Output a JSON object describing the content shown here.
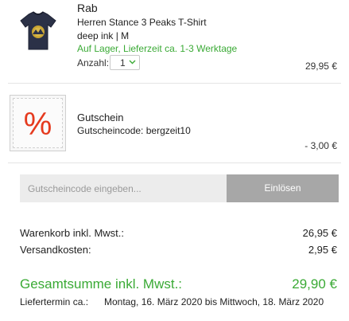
{
  "product": {
    "brand": "Rab",
    "name": "Herren Stance 3 Peaks T-Shirt",
    "variant": "deep ink | M",
    "stock": "Auf Lager, Lieferzeit ca. 1-3 Werktage",
    "quantity_label": "Anzahl:",
    "quantity_value": "1",
    "price": "29,95 €",
    "image_icon": "tshirt-icon"
  },
  "voucher": {
    "icon_symbol": "%",
    "title": "Gutschein",
    "code_text": "Gutscheincode: bergzeit10",
    "amount": "- 3,00 €"
  },
  "coupon_form": {
    "placeholder": "Gutscheincode eingeben...",
    "button_label": "Einlösen"
  },
  "totals": {
    "cart_label": "Warenkorb inkl. Mwst.:",
    "cart_value": "26,95 €",
    "shipping_label": "Versandkosten:",
    "shipping_value": "2,95 €",
    "grand_label": "Gesamtsumme inkl. Mwst.:",
    "grand_value": "29,90 €",
    "delivery_label": "Liefertermin ca.:",
    "delivery_value": "Montag, 16. März 2020 bis Mittwoch, 18. März 2020"
  },
  "colors": {
    "accent_green": "#3aaa35",
    "voucher_red": "#e53a1e",
    "button_grey": "#a7a7a7"
  }
}
